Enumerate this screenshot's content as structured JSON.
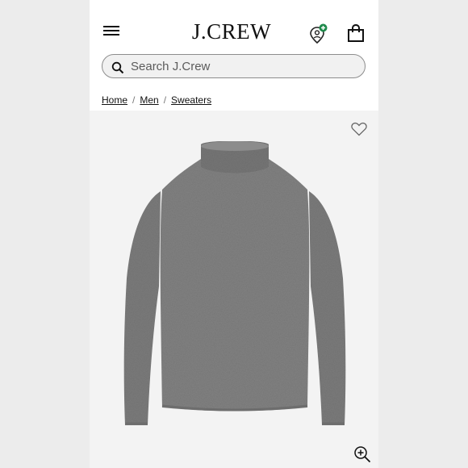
{
  "header": {
    "logo": "J.CREW",
    "icons": [
      "menu-icon",
      "location-pin-plus-icon",
      "shopping-bag-icon"
    ]
  },
  "search": {
    "placeholder": "Search J.Crew"
  },
  "breadcrumb": {
    "items": [
      "Home",
      "Men",
      "Sweaters"
    ],
    "separator": "/"
  },
  "product_image": {
    "icons": [
      "heart-icon",
      "zoom-in-icon"
    ],
    "description_color": "#7a7a7a"
  },
  "colors": {
    "page_background": "#ececec",
    "accent_green": "#1f8a4c"
  }
}
